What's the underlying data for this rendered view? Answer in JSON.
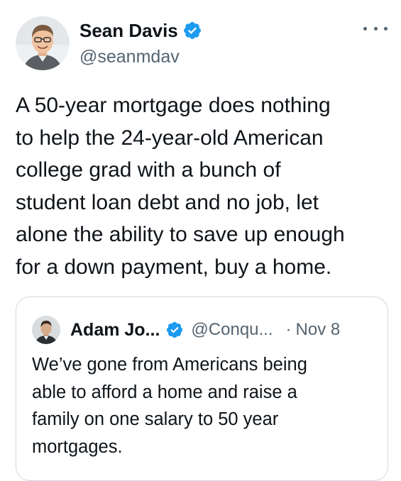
{
  "tweet": {
    "author": {
      "display_name": "Sean Davis",
      "handle": "@seanmdav",
      "verified": true,
      "avatar_icon": "person-avatar"
    },
    "more_icon": "more-horizontal-icon",
    "text_lines": [
      "A 50-year mortgage does nothing",
      "to help the 24-year-old American",
      "college grad with a bunch of",
      "student loan debt and no job, let",
      "alone the ability to save up enough",
      "for a down payment, buy a home."
    ]
  },
  "quote": {
    "author": {
      "display_name": "Adam Jo...",
      "handle": "@Conqu...",
      "verified": true,
      "avatar_icon": "person-avatar"
    },
    "separator": "·",
    "date": "Nov 8",
    "text_lines": [
      "We’ve gone from Americans being",
      "able to afford a home and raise a",
      "family on one salary to 50 year",
      "mortgages."
    ]
  },
  "colors": {
    "verified_blue": "#1d9bf0",
    "text_primary": "#0f1419",
    "text_secondary": "#536471",
    "border": "#cfd9de"
  }
}
